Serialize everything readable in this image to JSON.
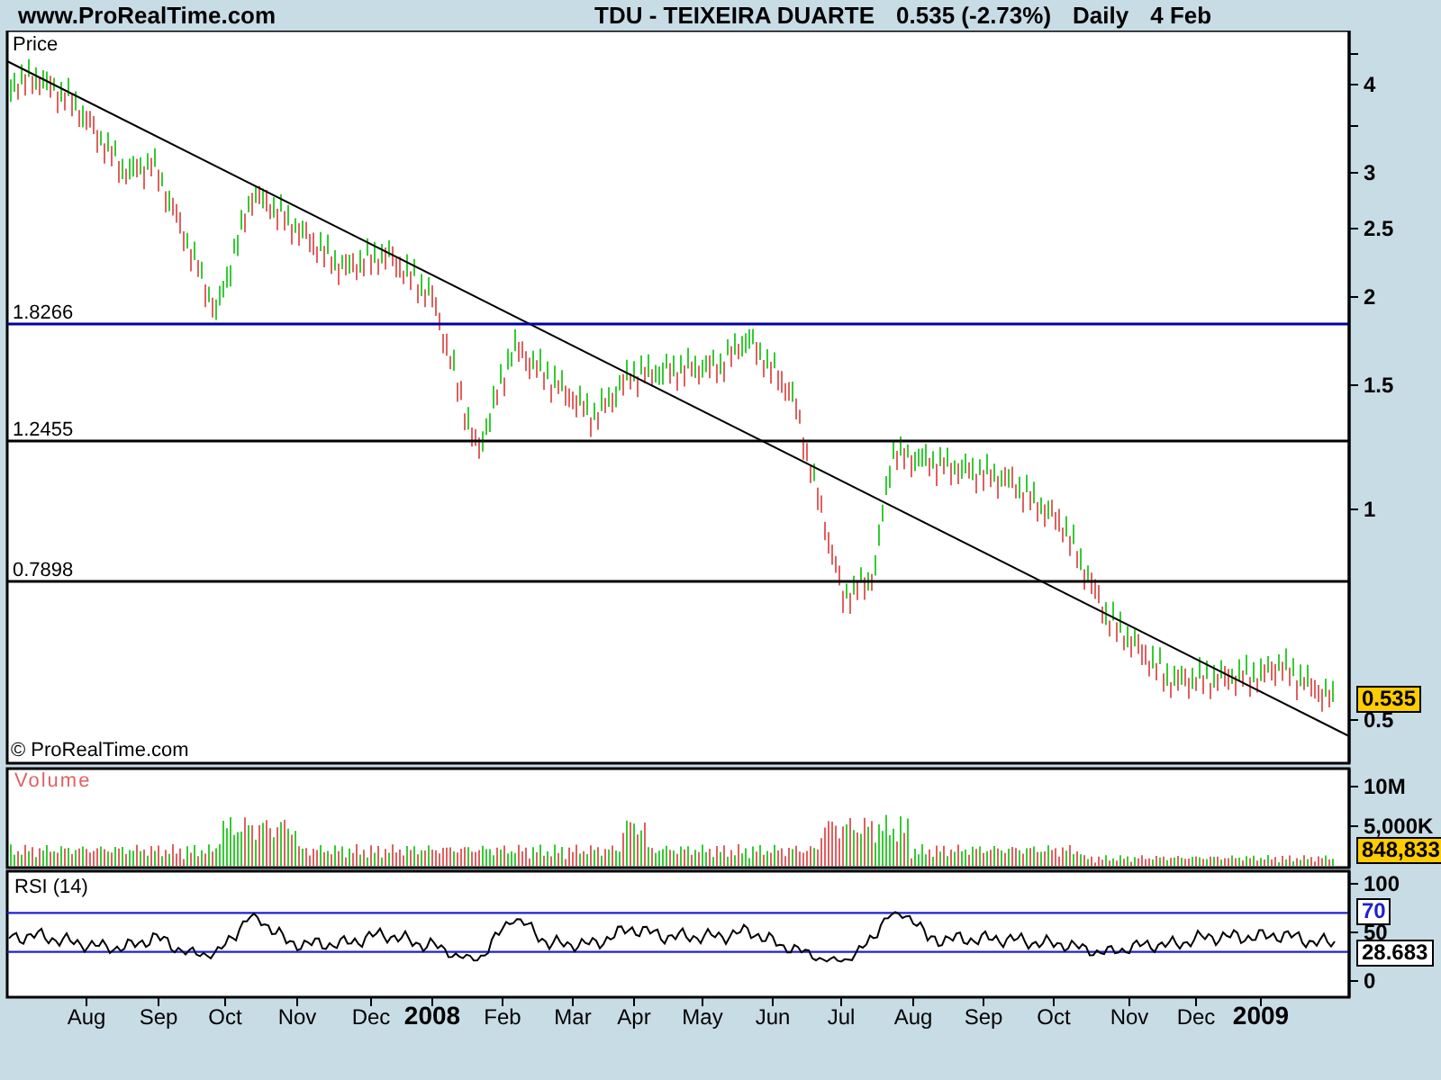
{
  "header": {
    "site": "www.ProRealTime.com",
    "symbol": "TDU - TEIXEIRA DUARTE",
    "quote": "0.535 (-2.73%)",
    "period": "Daily",
    "date": "4 Feb"
  },
  "price_panel": {
    "title": "Price",
    "copyright": "© ProRealTime.com",
    "last_value": "0.535",
    "levels": [
      {
        "label": "1.8266",
        "color": "#0000a0"
      },
      {
        "label": "1.2455",
        "color": "#000000"
      },
      {
        "label": "0.7898",
        "color": "#000000"
      }
    ],
    "axis_labels": [
      "4",
      "3",
      "2.5",
      "2",
      "1.5",
      "1",
      "0.5"
    ]
  },
  "volume_panel": {
    "title": "Volume",
    "axis_labels": [
      "10M",
      "5,000K"
    ],
    "last_value": "848,833"
  },
  "rsi_panel": {
    "title": "RSI (14)",
    "axis_labels": [
      "100",
      "50",
      "0"
    ],
    "overbought": "70",
    "last_value": "28.683"
  },
  "x_axis": [
    {
      "label": "Aug",
      "kind": "month"
    },
    {
      "label": "Sep",
      "kind": "month"
    },
    {
      "label": "Oct",
      "kind": "month"
    },
    {
      "label": "Nov",
      "kind": "month"
    },
    {
      "label": "Dec",
      "kind": "month"
    },
    {
      "label": "2008",
      "kind": "year"
    },
    {
      "label": "Feb",
      "kind": "month"
    },
    {
      "label": "Mar",
      "kind": "month"
    },
    {
      "label": "Apr",
      "kind": "month"
    },
    {
      "label": "May",
      "kind": "month"
    },
    {
      "label": "Jun",
      "kind": "month"
    },
    {
      "label": "Jul",
      "kind": "month"
    },
    {
      "label": "Aug",
      "kind": "month"
    },
    {
      "label": "Sep",
      "kind": "month"
    },
    {
      "label": "Oct",
      "kind": "month"
    },
    {
      "label": "Nov",
      "kind": "month"
    },
    {
      "label": "Dec",
      "kind": "month"
    },
    {
      "label": "2009",
      "kind": "year"
    }
  ]
}
